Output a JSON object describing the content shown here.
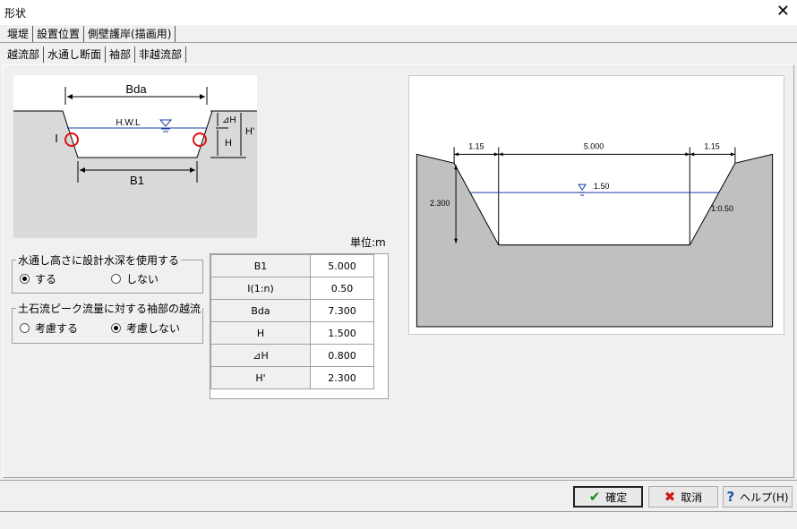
{
  "window": {
    "title": "形状",
    "close_glyph": "✕"
  },
  "tabs_main": [
    "堰堤",
    "設置位置",
    "側壁護岸(描画用)"
  ],
  "tabs_sub": [
    "越流部",
    "水通し断面",
    "袖部",
    "非越流部"
  ],
  "diagram": {
    "bda": "Bda",
    "b1": "B1",
    "hwl": "H.W.L",
    "i": "I",
    "dh": "⊿H",
    "h": "H",
    "hp": "H'"
  },
  "unit_label": "単位:m",
  "group1": {
    "legend": "水通し高さに設計水深を使用する",
    "opt_yes": "する",
    "opt_no": "しない",
    "selected": "yes"
  },
  "group2": {
    "legend": "土石流ピーク流量に対する袖部の越流",
    "opt_yes": "考慮する",
    "opt_no": "考慮しない",
    "selected": "no"
  },
  "table": [
    {
      "label": "B1",
      "value": "5.000"
    },
    {
      "label": "I(1:n)",
      "value": "0.50"
    },
    {
      "label": "Bda",
      "value": "7.300"
    },
    {
      "label": "H",
      "value": "1.500"
    },
    {
      "label": "⊿H",
      "value": "0.800"
    },
    {
      "label": "H'",
      "value": "2.300"
    }
  ],
  "preview": {
    "dim_left": "1.15",
    "dim_center": "5.000",
    "dim_right": "1.15",
    "height": "2.300",
    "water": "1.50",
    "slope": "1:0.50"
  },
  "buttons": {
    "ok": "確定",
    "cancel": "取消",
    "help": "ヘルプ(H)"
  },
  "colors": {
    "ok_icon": "#1a8a1a",
    "cancel_icon": "#d01818",
    "help_icon": "#1a50b0",
    "marker": "#e01010",
    "water": "#1a3ca8"
  }
}
